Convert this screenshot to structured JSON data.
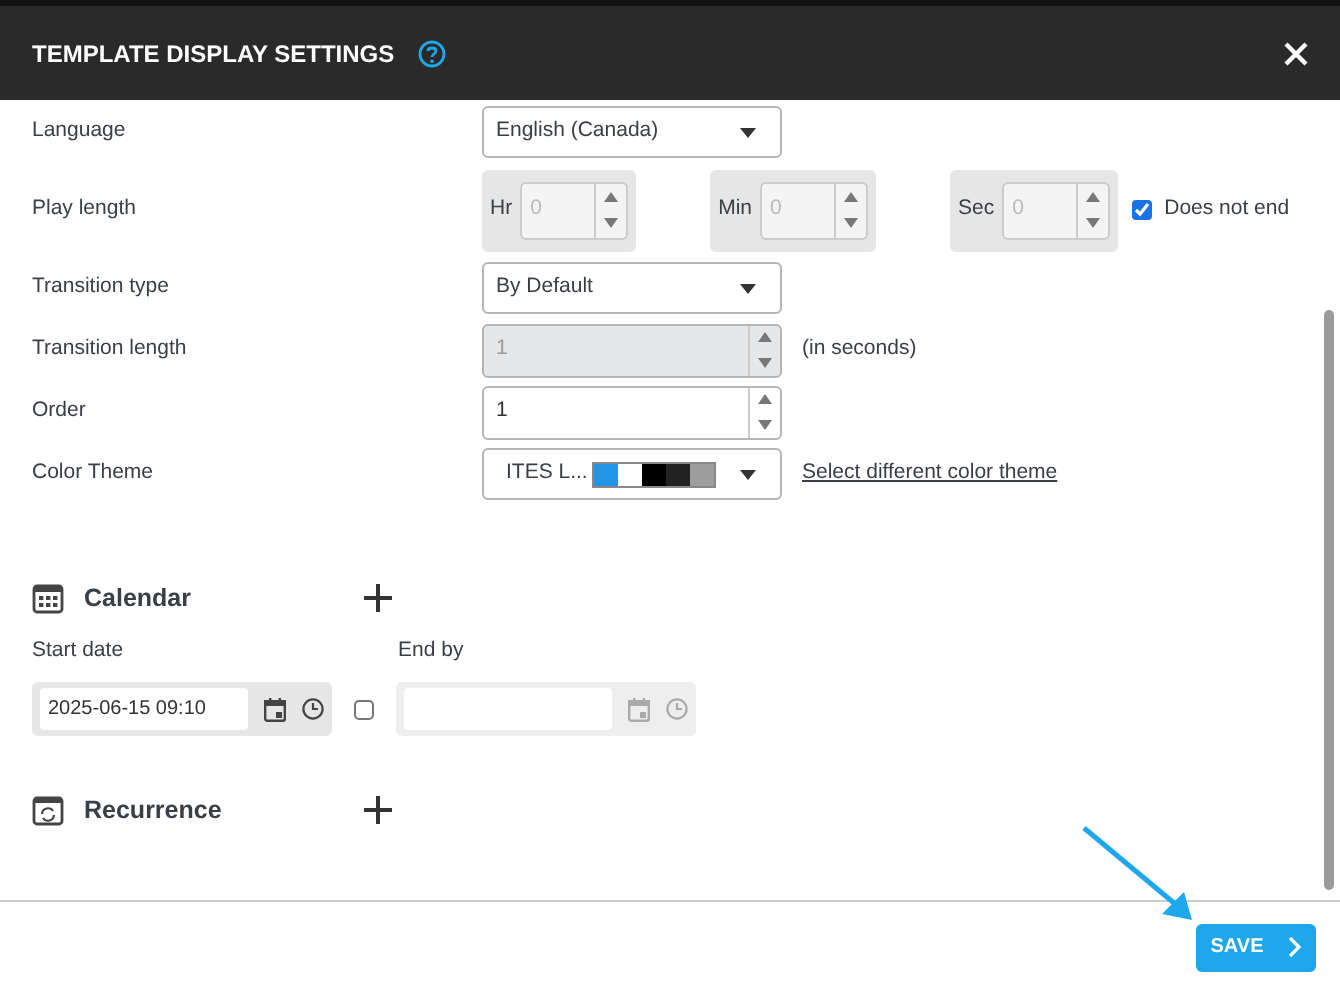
{
  "dialog": {
    "title": "TEMPLATE DISPLAY SETTINGS"
  },
  "fields": [
    {
      "kind": "select",
      "label": "Language",
      "value": "English (Canada)"
    },
    {
      "kind": "duration",
      "label": "Play length",
      "disabled": true,
      "parts": [
        {
          "unit": "Hr",
          "value": "0"
        },
        {
          "unit": "Min",
          "value": "0"
        },
        {
          "unit": "Sec",
          "value": "0"
        }
      ],
      "option": {
        "label": "Does not end",
        "checked": true
      }
    },
    {
      "kind": "select",
      "label": "Transition type",
      "value": "By Default"
    },
    {
      "kind": "number",
      "label": "Transition length",
      "value": "1",
      "disabled": true,
      "suffix": "(in seconds)"
    },
    {
      "kind": "number",
      "label": "Order",
      "value": "1",
      "disabled": false
    },
    {
      "kind": "theme",
      "label": "Color Theme",
      "value": "ITES L...",
      "swatches": [
        {
          "color": "#2196e8"
        },
        {
          "color": "#ffffff"
        },
        {
          "color": "#000000"
        },
        {
          "color": "#222222"
        },
        {
          "color": "#9e9e9e"
        }
      ],
      "link": "Select different color theme"
    }
  ],
  "calendar": {
    "title": "Calendar",
    "start": {
      "label": "Start date",
      "value": "2025-06-15 09:10"
    },
    "end": {
      "label": "End by",
      "checked": false
    }
  },
  "recurrence": {
    "title": "Recurrence"
  },
  "footer": {
    "save": "SAVE"
  }
}
